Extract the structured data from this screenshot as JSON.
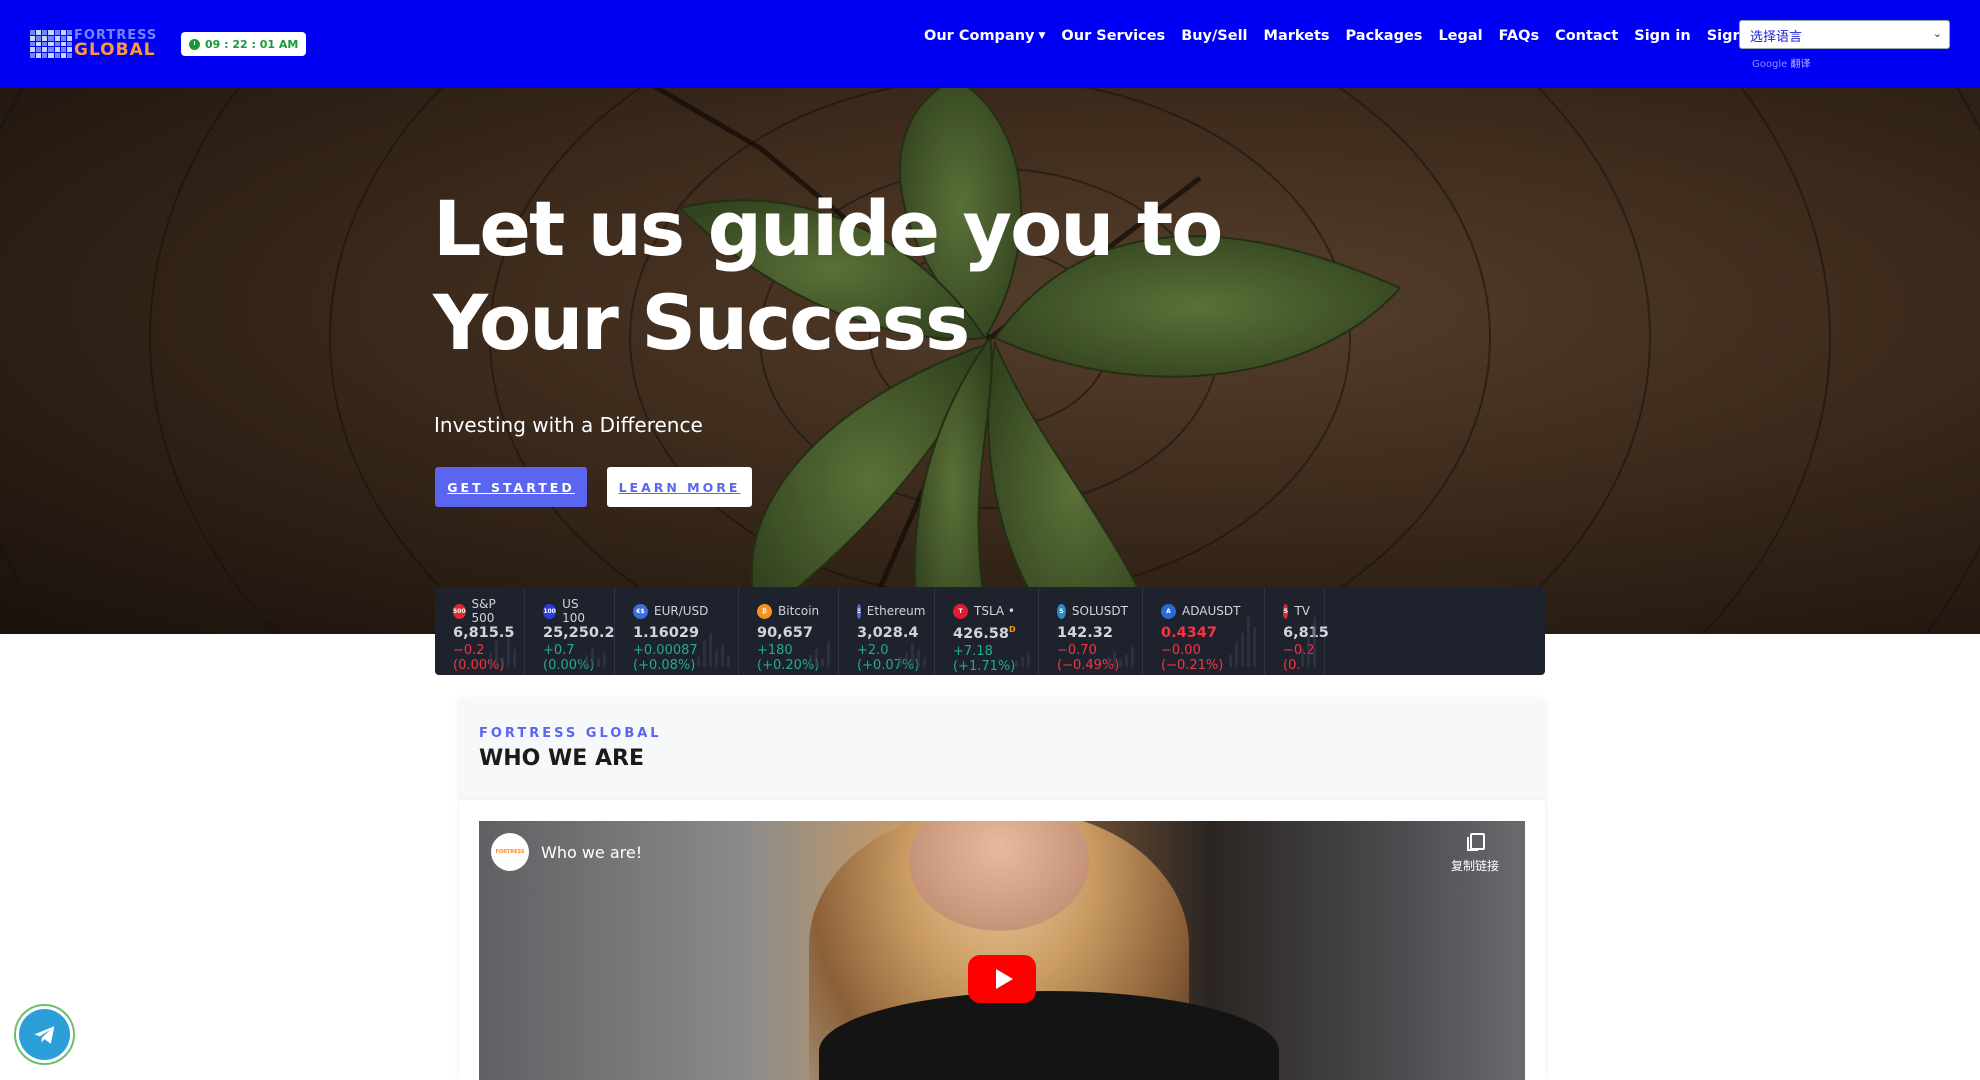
{
  "brand": {
    "line1": "FORTRESS",
    "line2": "GLOBAL"
  },
  "clock": {
    "time": "09 : 22 : 01 AM"
  },
  "nav": {
    "items": [
      {
        "label": "Our Company",
        "has_dropdown": true
      },
      {
        "label": "Our Services"
      },
      {
        "label": "Buy/Sell"
      },
      {
        "label": "Markets"
      },
      {
        "label": "Packages"
      },
      {
        "label": "Legal"
      },
      {
        "label": "FAQs"
      },
      {
        "label": "Contact"
      },
      {
        "label": "Sign in"
      },
      {
        "label": "Sign up"
      }
    ]
  },
  "language": {
    "selected": "选择语言",
    "powered_google": "Google",
    "powered_text": "翻译"
  },
  "hero": {
    "title_line1": "Let us guide you to",
    "title_line2": "Your Success",
    "subtitle": "Investing with a Difference",
    "primary_button": "GET STARTED",
    "secondary_button": "LEARN MORE"
  },
  "ticker": [
    {
      "name": "S&P 500",
      "icon": "500",
      "icon_color": "#e0282e",
      "price": "6,815.5",
      "change": "−0.2 (0.00%)",
      "dir": "down"
    },
    {
      "name": "US 100",
      "icon": "100",
      "icon_color": "#2a3ee0",
      "price": "25,250.2",
      "change": "+0.7 (0.00%)",
      "dir": "up"
    },
    {
      "name": "EUR/USD",
      "icon": "€$",
      "icon_color": "#3b6de0",
      "price": "1.16029",
      "change": "+0.00087 (+0.08%)",
      "dir": "up"
    },
    {
      "name": "Bitcoin",
      "icon": "₿",
      "icon_color": "#f7931a",
      "price": "90,657",
      "change": "+180 (+0.20%)",
      "dir": "up"
    },
    {
      "name": "Ethereum",
      "icon": "Ξ",
      "icon_color": "#5a6bd6",
      "price": "3,028.4",
      "change": "+2.0 (+0.07%)",
      "dir": "up"
    },
    {
      "name": "TSLA",
      "icon": "T",
      "icon_color": "#e31937",
      "price": "426.58",
      "change": "+7.18 (+1.71%)",
      "dir": "up",
      "suffix": "D",
      "dot": "•"
    },
    {
      "name": "SOLUSDT",
      "icon": "S",
      "icon_color": "#2c8ac4",
      "price": "142.32",
      "change": "−0.70 (−0.49%)",
      "dir": "down"
    },
    {
      "name": "ADAUSDT",
      "icon": "A",
      "icon_color": "#2a6ad6",
      "price": "0.4347",
      "change": "−0.00 (−0.21%)",
      "dir": "down",
      "price_red": true
    },
    {
      "name": "TV",
      "icon": "5",
      "icon_color": "#e0282e",
      "price": "6,815",
      "change": "−0.2 (0.",
      "dir": "down"
    }
  ],
  "who": {
    "kicker": "FORTRESS GLOBAL",
    "title": "WHO WE ARE"
  },
  "video": {
    "title": "Who we are!",
    "copy_link": "复制链接"
  }
}
